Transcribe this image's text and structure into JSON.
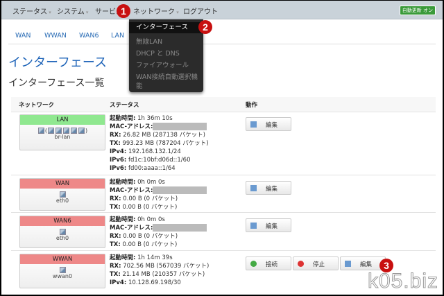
{
  "nav": {
    "items": [
      "ステータス",
      "システム",
      "サービス",
      "ネットワーク",
      "ログアウト"
    ],
    "badge": "自動更新 オン"
  },
  "dropdown": {
    "items": [
      "インターフェース",
      "無線LAN",
      "DHCP と DNS",
      "ファイアウォール",
      "WAN接続自動選択機",
      "能"
    ]
  },
  "tabs": [
    "WAN",
    "WWAN",
    "WAN6",
    "LAN"
  ],
  "page": {
    "title": "インターフェース",
    "subtitle": "インターフェース一覧"
  },
  "table": {
    "headers": [
      "ネットワーク",
      "ステータス",
      "動作"
    ]
  },
  "rows": [
    {
      "name": "LAN",
      "device": "br-lan",
      "lines": [
        [
          "起動時間:",
          "1h 36m 10s"
        ],
        [
          "MAC-アドレス:",
          ""
        ],
        [
          "RX:",
          "26.82 MB (287138 パケット)"
        ],
        [
          "TX:",
          "993.23 MB (787204 パケット)"
        ],
        [
          "IPv4:",
          "192.168.132.1/24"
        ],
        [
          "IPv6:",
          "fd1c:10bf:d06d::1/60"
        ],
        [
          "IPv6:",
          "fd00:aaaa::1/64"
        ]
      ]
    },
    {
      "name": "WAN",
      "device": "eth0",
      "lines": [
        [
          "起動時間:",
          "0h 0m 0s"
        ],
        [
          "MAC-アドレス:",
          ""
        ],
        [
          "RX:",
          "0.00 B (0 パケット)"
        ],
        [
          "TX:",
          "0.00 B (0 パケット)"
        ]
      ]
    },
    {
      "name": "WAN6",
      "device": "eth0",
      "lines": [
        [
          "起動時間:",
          "0h 0m 0s"
        ],
        [
          "MAC-アドレス:",
          ""
        ],
        [
          "RX:",
          "0.00 B (0 パケット)"
        ],
        [
          "TX:",
          "0.00 B (0 パケット)"
        ]
      ]
    },
    {
      "name": "WWAN",
      "device": "wwan0",
      "lines": [
        [
          "起動時間:",
          "1h 14m 39s"
        ],
        [
          "RX:",
          "702.56 MB (567039 パケット)"
        ],
        [
          "TX:",
          "21.14 MB (210357 パケット)"
        ],
        [
          "IPv4:",
          "10.128.69.198/30"
        ]
      ]
    }
  ],
  "buttons": {
    "edit": "編集",
    "connect": "接続",
    "stop": "停止"
  },
  "markers": [
    "1",
    "2",
    "3"
  ],
  "watermark": "k05.biz"
}
